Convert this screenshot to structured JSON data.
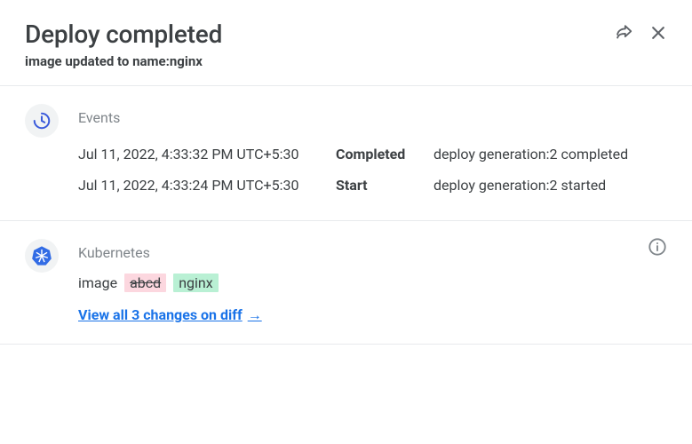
{
  "header": {
    "title": "Deploy completed",
    "subtitle": "image updated to name:nginx"
  },
  "events": {
    "label": "Events",
    "rows": [
      {
        "time": "Jul 11, 2022, 4:33:32 PM UTC+5:30",
        "status": "Completed",
        "message": "deploy generation:2 completed"
      },
      {
        "time": "Jul 11, 2022, 4:33:24 PM UTC+5:30",
        "status": "Start",
        "message": "deploy generation:2 started"
      }
    ]
  },
  "kubernetes": {
    "label": "Kubernetes",
    "diff": {
      "key": "image",
      "old": "abcd",
      "new": "nginx"
    },
    "view_link": "View all 3 changes on diff",
    "view_arrow": "→"
  },
  "icons": {
    "share": "share-icon",
    "close": "close-icon",
    "clock": "clock-icon",
    "k8s": "kubernetes-icon",
    "info": "info-icon"
  }
}
